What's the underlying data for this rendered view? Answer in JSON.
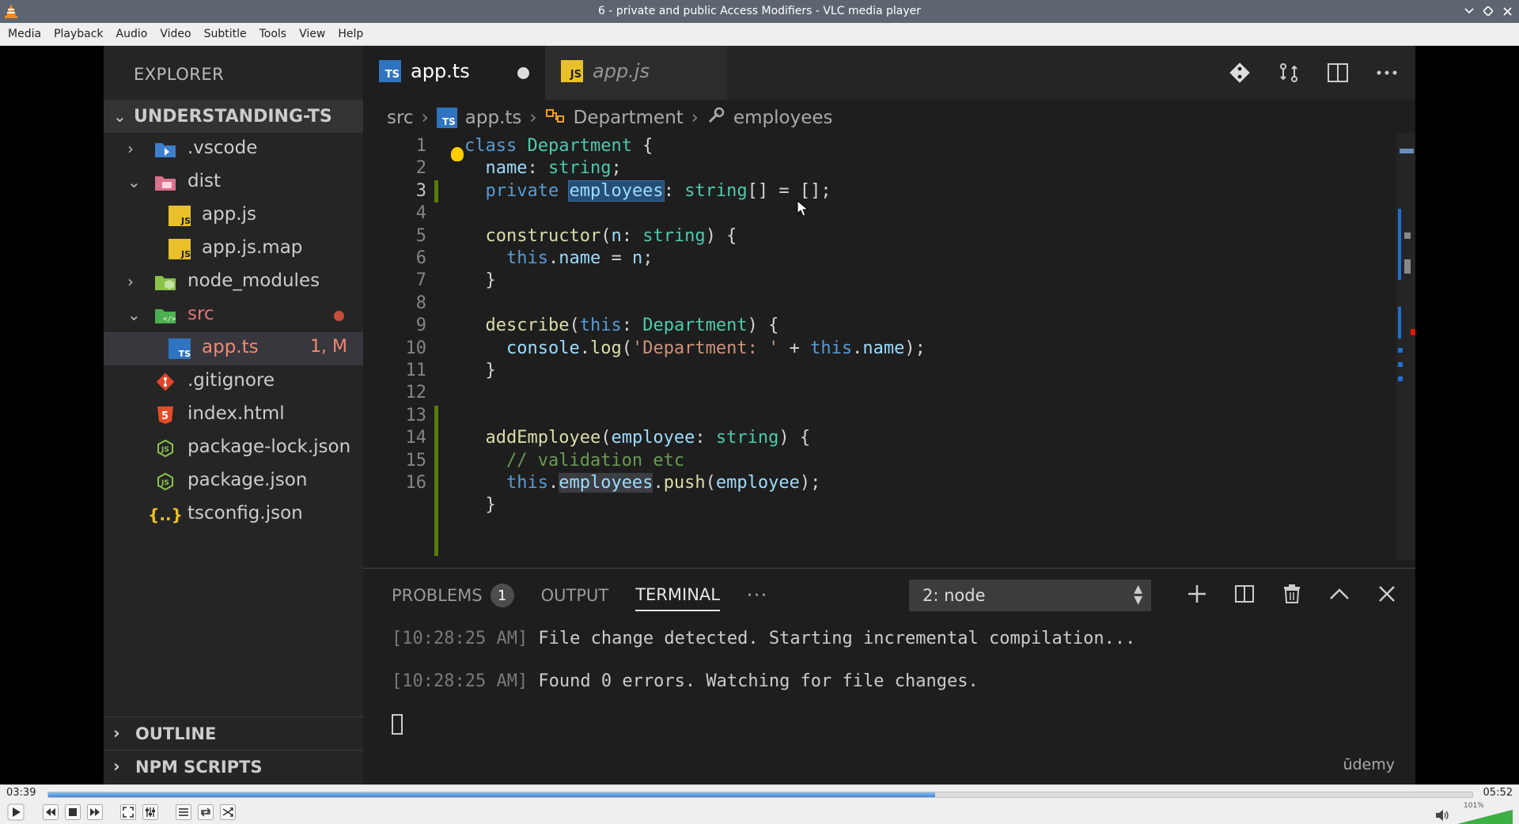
{
  "window": {
    "title": "6 - private and public Access Modifiers - VLC media player"
  },
  "menu": [
    "Media",
    "Playback",
    "Audio",
    "Video",
    "Subtitle",
    "Tools",
    "View",
    "Help"
  ],
  "vscode": {
    "explorer": {
      "title": "EXPLORER",
      "project": "UNDERSTANDING-TS",
      "tree": [
        {
          "label": ".vscode",
          "icon": "folder-vscode-icon"
        },
        {
          "label": "dist",
          "icon": "folder-dist-icon"
        },
        {
          "label": "app.js",
          "icon": "js-file-icon"
        },
        {
          "label": "app.js.map",
          "icon": "js-map-file-icon"
        },
        {
          "label": "node_modules",
          "icon": "folder-node-icon"
        },
        {
          "label": "src",
          "icon": "folder-src-icon"
        },
        {
          "label": "app.ts",
          "icon": "ts-file-icon",
          "badge": "1, M"
        },
        {
          "label": ".gitignore",
          "icon": "git-icon"
        },
        {
          "label": "index.html",
          "icon": "html-icon"
        },
        {
          "label": "package-lock.json",
          "icon": "node-json-icon"
        },
        {
          "label": "package.json",
          "icon": "node-json-icon"
        },
        {
          "label": "tsconfig.json",
          "icon": "json-braces-icon"
        }
      ],
      "sections": [
        "OUTLINE",
        "NPM SCRIPTS"
      ]
    },
    "tabs": [
      {
        "label": "app.ts",
        "icon_text": "TS",
        "active": true,
        "modified": true
      },
      {
        "label": "app.js",
        "icon_text": "JS",
        "active": false
      }
    ],
    "breadcrumb": [
      "src",
      "app.ts",
      "Department",
      "employees"
    ],
    "line_numbers": [
      "1",
      "2",
      "3",
      "4",
      "5",
      "6",
      "7",
      "8",
      "9",
      "10",
      "11",
      "12",
      "13",
      "14",
      "15",
      "16"
    ],
    "panel": {
      "tabs": [
        "PROBLEMS",
        "OUTPUT",
        "TERMINAL"
      ],
      "problems_count": "1",
      "more": "···",
      "terminal_select": "2: node",
      "terminal_lines": [
        {
          "ts": "[10:28:25 AM]",
          "text": " File change detected. Starting incremental compilation..."
        },
        {
          "ts": "[10:28:25 AM]",
          "text": " Found 0 errors. Watching for file changes."
        }
      ]
    },
    "watermark": "ūdemy"
  },
  "player": {
    "elapsed": "03:39",
    "total": "05:52",
    "progress": 0.623,
    "volume_label": "101%",
    "volume": 1.01
  },
  "colors": {
    "accent": "#3d84d6",
    "ts_blue": "#2f74c0",
    "js_yellow": "#e8c02a",
    "git_orange": "#e24329"
  }
}
